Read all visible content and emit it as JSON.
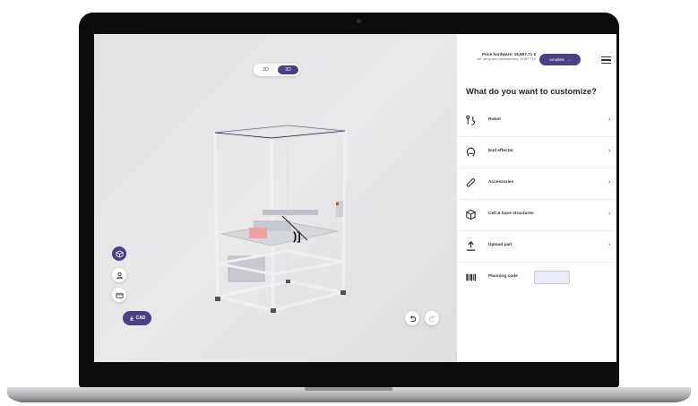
{
  "viewport": {
    "view_toggle": {
      "option_2d": "2D",
      "option_3d": "3D",
      "selected": "3D"
    },
    "left_tools": [
      {
        "name": "cube-view-icon"
      },
      {
        "name": "user-icon"
      },
      {
        "name": "card-icon"
      }
    ],
    "cad_button": {
      "label": "CAD"
    },
    "undo_icon": "undo-icon",
    "redo_icon": "redo-icon"
  },
  "panel": {
    "price_label": "Price hardware: 15,697.71 €",
    "price_sub": "incl. set up and commissioning: 15,697.71 €",
    "complete_label": "complete",
    "title": "What do you want to customize?",
    "items": [
      {
        "label": "Robot",
        "icon": "robot-arm-icon"
      },
      {
        "label": "End effector",
        "icon": "gripper-icon"
      },
      {
        "label": "Accessories",
        "icon": "paperclip-icon"
      },
      {
        "label": "Cell & base structures",
        "icon": "cube-icon"
      },
      {
        "label": "Upload part",
        "icon": "upload-icon"
      }
    ],
    "planning_code_label": "Planning code",
    "planning_code_value": ""
  },
  "colors": {
    "accent": "#4b3f86",
    "viewport_bg": "#e7e7e9",
    "bezel": "#0c0c0d"
  }
}
